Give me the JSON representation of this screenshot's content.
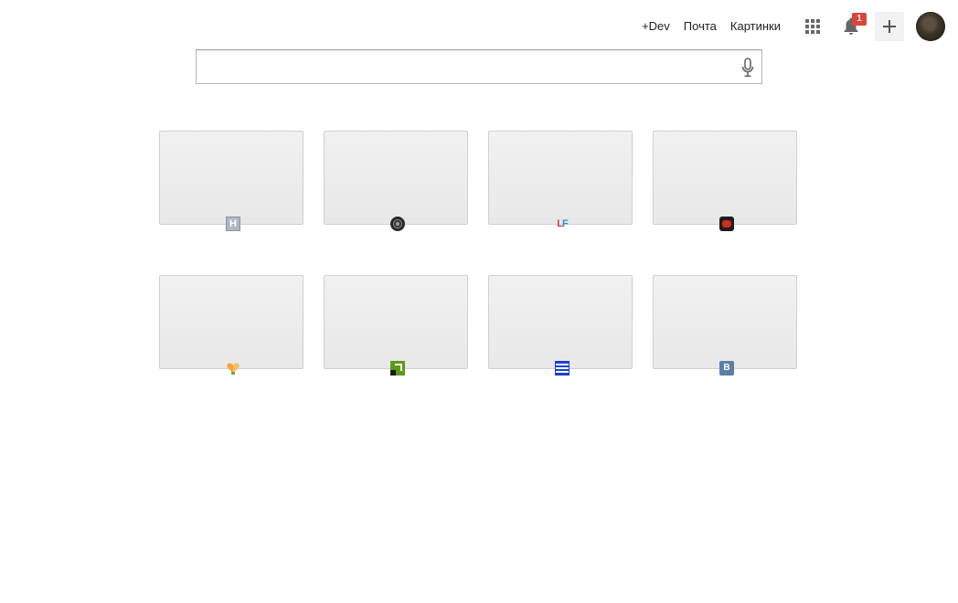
{
  "header": {
    "links": [
      {
        "label": "+Dev"
      },
      {
        "label": "Почта"
      },
      {
        "label": "Картинки"
      }
    ],
    "notifications_count": "1",
    "share_label": "+"
  },
  "search": {
    "value": "",
    "placeholder": ""
  },
  "tiles": [
    {
      "favicon": "h-icon",
      "favicon_text": "H"
    },
    {
      "favicon": "film-reel-icon"
    },
    {
      "favicon": "lf-icon",
      "favicon_text_l": "L",
      "favicon_text_f": "F"
    },
    {
      "favicon": "red-square-icon"
    },
    {
      "favicon": "heart-icon"
    },
    {
      "favicon": "green-arrow-icon"
    },
    {
      "favicon": "blue-striped-icon"
    },
    {
      "favicon": "vk-icon",
      "favicon_text": "В"
    }
  ],
  "colors": {
    "badge": "#db4437",
    "tile_bg": "#efefef",
    "vk": "#5b7fa6"
  }
}
